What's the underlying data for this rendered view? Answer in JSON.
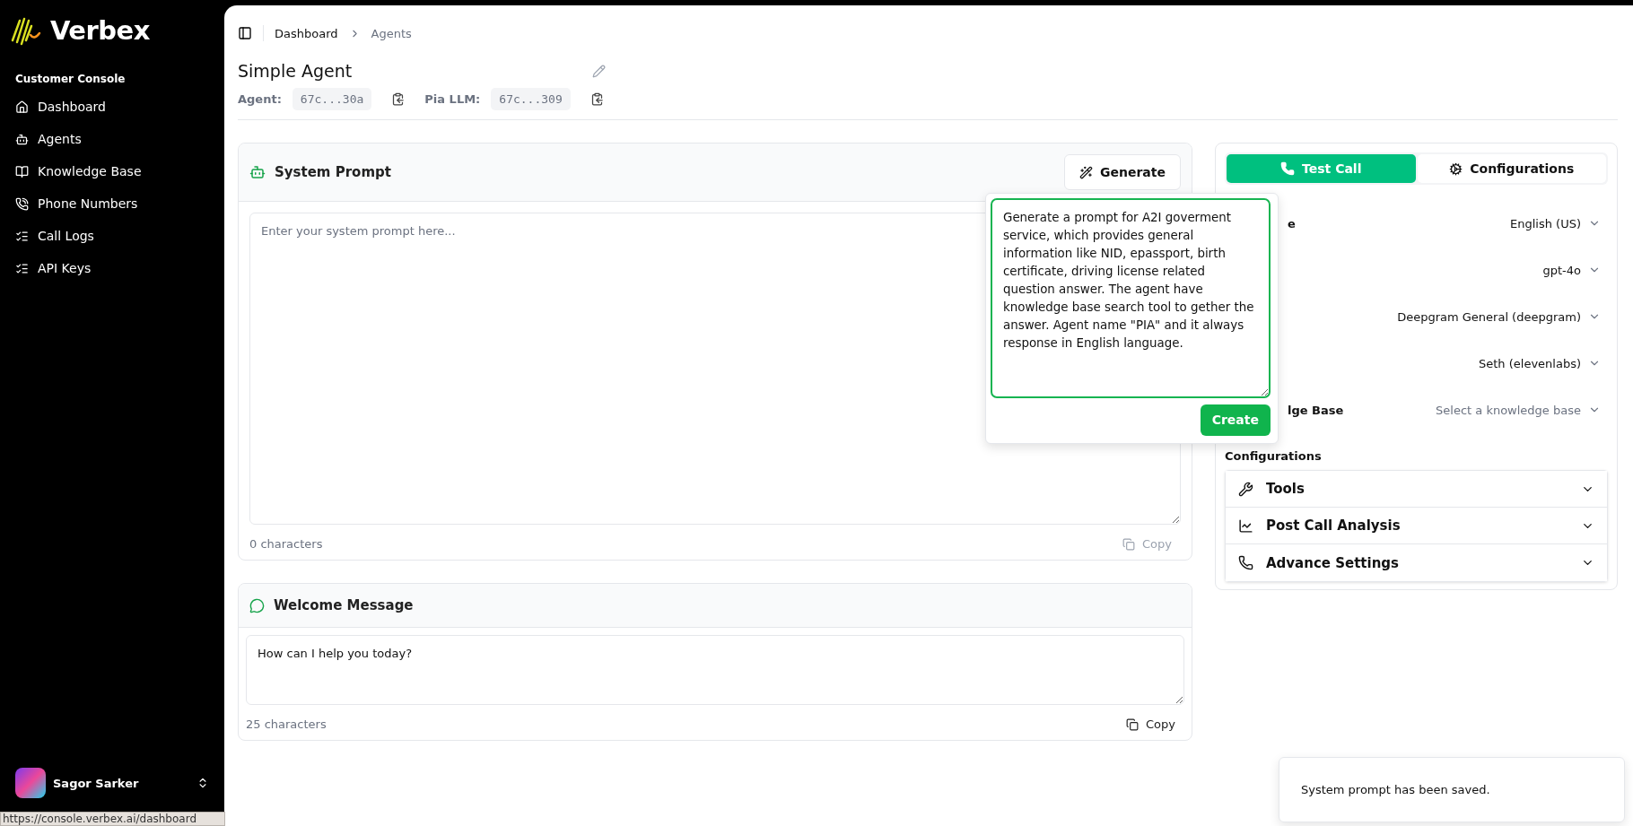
{
  "logo": {
    "name": "Verbex"
  },
  "sidebar": {
    "section": "Customer Console",
    "items": [
      {
        "label": "Dashboard"
      },
      {
        "label": "Agents"
      },
      {
        "label": "Knowledge Base"
      },
      {
        "label": "Phone Numbers"
      },
      {
        "label": "Call Logs"
      },
      {
        "label": "API Keys"
      }
    ],
    "user": {
      "name": "Sagor Sarker"
    }
  },
  "browser_status": "https://console.verbex.ai/dashboard",
  "breadcrumb": [
    {
      "label": "Dashboard",
      "current": false
    },
    {
      "label": "Agents",
      "current": true
    }
  ],
  "agent": {
    "title": "Simple Agent",
    "ids": [
      {
        "label": "Agent:",
        "value": "67c...30a"
      },
      {
        "label": "Pia LLM:",
        "value": "67c...309"
      }
    ]
  },
  "system_prompt": {
    "title": "System Prompt",
    "generate_button": "Generate",
    "placeholder": "Enter your system prompt here...",
    "count": "0 characters",
    "copy_button": "Copy",
    "copy_disabled": true
  },
  "welcome": {
    "title": "Welcome Message",
    "value": "How can I help you today?",
    "count": "25 characters",
    "copy_button": "Copy",
    "copy_disabled": false
  },
  "tabs": [
    {
      "label": "Test Call",
      "selected": true
    },
    {
      "label": "Configurations",
      "selected": false
    }
  ],
  "settings": [
    {
      "label": "e",
      "value": "English (US)"
    },
    {
      "value": "gpt-4o"
    },
    {
      "value": "Deepgram General (deepgram)"
    },
    {
      "value": "Seth (elevenlabs)"
    },
    {
      "label": "lge Base",
      "placeholder": "Select a knowledge base"
    }
  ],
  "configurations": {
    "title": "Configurations",
    "sections": [
      {
        "label": "Tools",
        "expanded": false
      },
      {
        "label": "Post Call Analysis",
        "expanded": false
      },
      {
        "label": "Advance Settings",
        "expanded": false
      }
    ]
  },
  "generate_popup": {
    "value": "Generate a prompt for A2I goverment service, which provides general information like NID, epassport, birth certificate, driving license related question answer. The agent have knowledge base search tool to gether the answer. Agent name \"PIA\" and it always response in English language.",
    "button": "Create"
  },
  "toast": "System prompt has been saved."
}
